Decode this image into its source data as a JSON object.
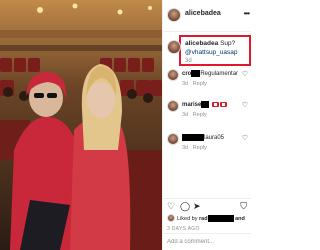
{
  "post": {
    "username": "alicebadea",
    "more_icon": "more-options-icon"
  },
  "caption": {
    "username": "alicebadea",
    "text": "Sup?",
    "mention": "@vhattsup_uasap",
    "time": "3d"
  },
  "comments": [
    {
      "user_prefix": "cro",
      "text": "Regulamentar",
      "time": "3d",
      "reply": "Reply"
    },
    {
      "user_prefix": "marise",
      "text": "",
      "time": "3d",
      "reply": "Reply"
    },
    {
      "user_prefix": "",
      "text": "laura05",
      "time": "3d",
      "reply": "Reply"
    }
  ],
  "likes": {
    "prefix": "Liked by",
    "user": "rad",
    "suffix": "and"
  },
  "date": "3 DAYS AGO",
  "add_comment": {
    "placeholder": "Add a comment..."
  },
  "colors": {
    "highlight": "#e0182d",
    "link": "#00376b"
  }
}
